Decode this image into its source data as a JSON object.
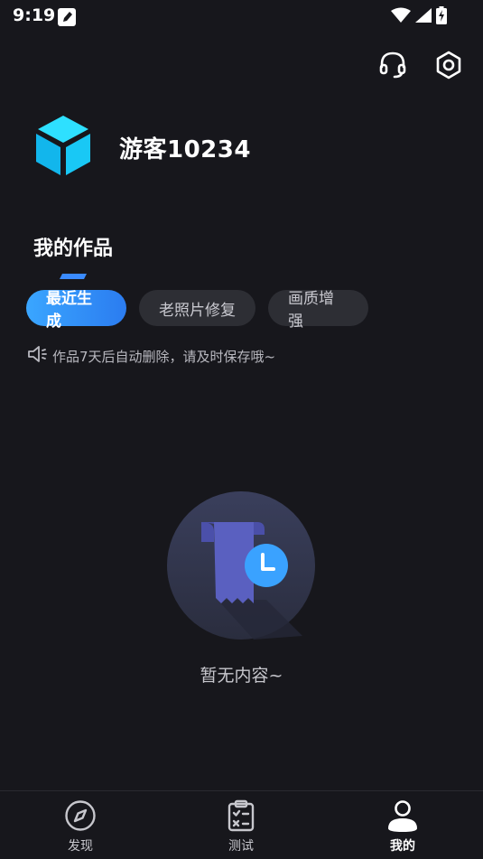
{
  "status_bar": {
    "time": "9:19"
  },
  "profile": {
    "username": "游客10234"
  },
  "section": {
    "title": "我的作品"
  },
  "tabs": [
    {
      "label": "最近生成",
      "active": true
    },
    {
      "label": "老照片修复",
      "active": false
    },
    {
      "label": "画质增强",
      "active": false
    }
  ],
  "notice": {
    "text": "作品7天后自动删除，请及时保存哦~"
  },
  "empty_state": {
    "text": "暂无内容~"
  },
  "bottom_nav": [
    {
      "label": "发现",
      "icon": "compass-icon",
      "active": false
    },
    {
      "label": "测试",
      "icon": "checklist-icon",
      "active": false
    },
    {
      "label": "我的",
      "icon": "user-icon",
      "active": true
    }
  ],
  "colors": {
    "background": "#17171c",
    "accent": "#3aa6ff",
    "tab_inactive": "#2d2e34",
    "avatar_cube": "#19c8f5"
  }
}
